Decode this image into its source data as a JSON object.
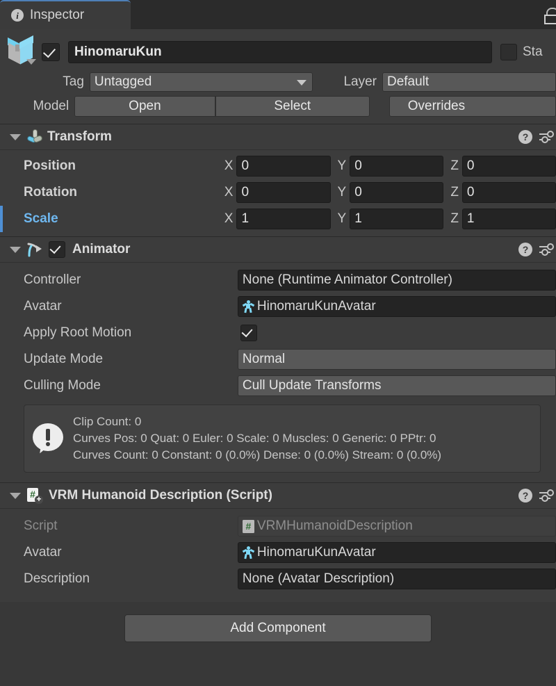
{
  "window": {
    "tab_label": "Inspector",
    "tab_icon": "info-icon",
    "lock_icon": "lock-icon"
  },
  "object_header": {
    "prefab_icon": "prefab-box-icon",
    "enabled_checkbox": true,
    "name": "HinomaruKun",
    "static_label": "Sta",
    "tag_label": "Tag",
    "tag_value": "Untagged",
    "layer_label": "Layer",
    "layer_value": "Default",
    "model_label": "Model",
    "open_button": "Open",
    "select_button": "Select",
    "overrides_button": "Overrides"
  },
  "components": [
    {
      "id": "transform",
      "title": "Transform",
      "icon": "transform-axis-icon",
      "has_checkbox": false,
      "help_icon": "help-icon",
      "preset_icon": "preset-settings-icon",
      "rows": [
        {
          "label": "Position",
          "bold": true,
          "highlight": false,
          "axes": [
            "X",
            "Y",
            "Z"
          ],
          "values": [
            "0",
            "0",
            "0"
          ]
        },
        {
          "label": "Rotation",
          "bold": true,
          "highlight": false,
          "axes": [
            "X",
            "Y",
            "Z"
          ],
          "values": [
            "0",
            "0",
            "0"
          ]
        },
        {
          "label": "Scale",
          "bold": true,
          "highlight": true,
          "axes": [
            "X",
            "Y",
            "Z"
          ],
          "values": [
            "1",
            "1",
            "1"
          ]
        }
      ]
    },
    {
      "id": "animator",
      "title": "Animator",
      "icon": "animator-arrow-icon",
      "has_checkbox": true,
      "checked": true,
      "help_icon": "help-icon",
      "preset_icon": "preset-settings-icon",
      "fields": [
        {
          "label": "Controller",
          "type": "object",
          "value": "None (Runtime Animator Controller)",
          "icon": null
        },
        {
          "label": "Avatar",
          "type": "object",
          "value": "HinomaruKunAvatar",
          "icon": "avatar-icon"
        },
        {
          "label": "Apply Root Motion",
          "type": "checkbox",
          "value": true
        },
        {
          "label": "Update Mode",
          "type": "enum",
          "value": "Normal"
        },
        {
          "label": "Culling Mode",
          "type": "enum",
          "value": "Cull Update Transforms"
        }
      ],
      "info_box": {
        "icon": "info-bubble-icon",
        "lines": [
          "Clip Count: 0",
          "Curves Pos: 0 Quat: 0 Euler: 0 Scale: 0 Muscles: 0 Generic: 0 PPtr: 0",
          "Curves Count: 0 Constant: 0 (0.0%) Dense: 0 (0.0%) Stream: 0 (0.0%)"
        ]
      }
    },
    {
      "id": "vrm-humanoid-description",
      "title": "VRM Humanoid Description (Script)",
      "icon": "script-add-icon",
      "has_checkbox": false,
      "overridden": true,
      "help_icon": "help-icon",
      "preset_icon": "preset-settings-icon",
      "fields": [
        {
          "label": "Script",
          "type": "object",
          "value": "VRMHumanoidDescription",
          "icon": "script-icon",
          "disabled": true
        },
        {
          "label": "Avatar",
          "type": "object",
          "value": "HinomaruKunAvatar",
          "icon": "avatar-icon"
        },
        {
          "label": "Description",
          "type": "object",
          "value": "None (Avatar Description)",
          "icon": null
        }
      ]
    }
  ],
  "footer": {
    "add_component_label": "Add Component"
  },
  "colors": {
    "panel_bg": "#383838",
    "component_bg": "#3c3c3c",
    "tabbar_bg": "#2b2b2b",
    "accent_blue": "#4e8fd4",
    "highlight_text": "#6fb8f0",
    "avatar_cyan": "#7fd8f5",
    "field_bg": "#242424",
    "enum_bg": "#585858"
  }
}
